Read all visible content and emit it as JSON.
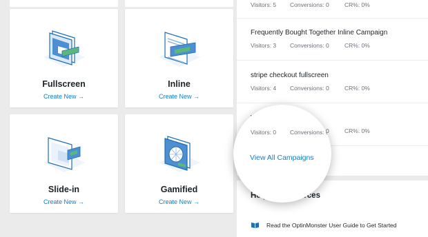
{
  "cards": [
    {
      "title": "Fullscreen",
      "create": "Create New →",
      "icon": "fullscreen-icon"
    },
    {
      "title": "Inline",
      "create": "Create New →",
      "icon": "inline-icon"
    },
    {
      "title": "Slide-in",
      "create": "Create New →",
      "icon": "slide-in-icon"
    },
    {
      "title": "Gamified",
      "create": "Create New →",
      "icon": "gamified-icon"
    }
  ],
  "campaigns": [
    {
      "name": "",
      "visitors": "Visitors: 5",
      "conversions": "Conversions: 0",
      "cr": "CR%: 0%"
    },
    {
      "name": "Frequently Bought Together Inline Campaign",
      "visitors": "Visitors: 3",
      "conversions": "Conversions: 0",
      "cr": "CR%: 0%"
    },
    {
      "name": "stripe checkout fullscreen",
      "visitors": "Visitors: 4",
      "conversions": "Conversions: 0",
      "cr": "CR%: 0%"
    },
    {
      "name": "WP Simple Pay",
      "visitors": "Visitors: 0",
      "conversions": "Conversions: 0",
      "cr": "CR%: 0%"
    }
  ],
  "view_all": "View All Campaigns",
  "help": {
    "title": "Helpful Resources",
    "item": "Read the OptinMonster User Guide to Get Started"
  },
  "colors": {
    "accent": "#0e7fd1",
    "illustration": "#1f6fb2",
    "illustration_light": "#e6f1fb"
  }
}
